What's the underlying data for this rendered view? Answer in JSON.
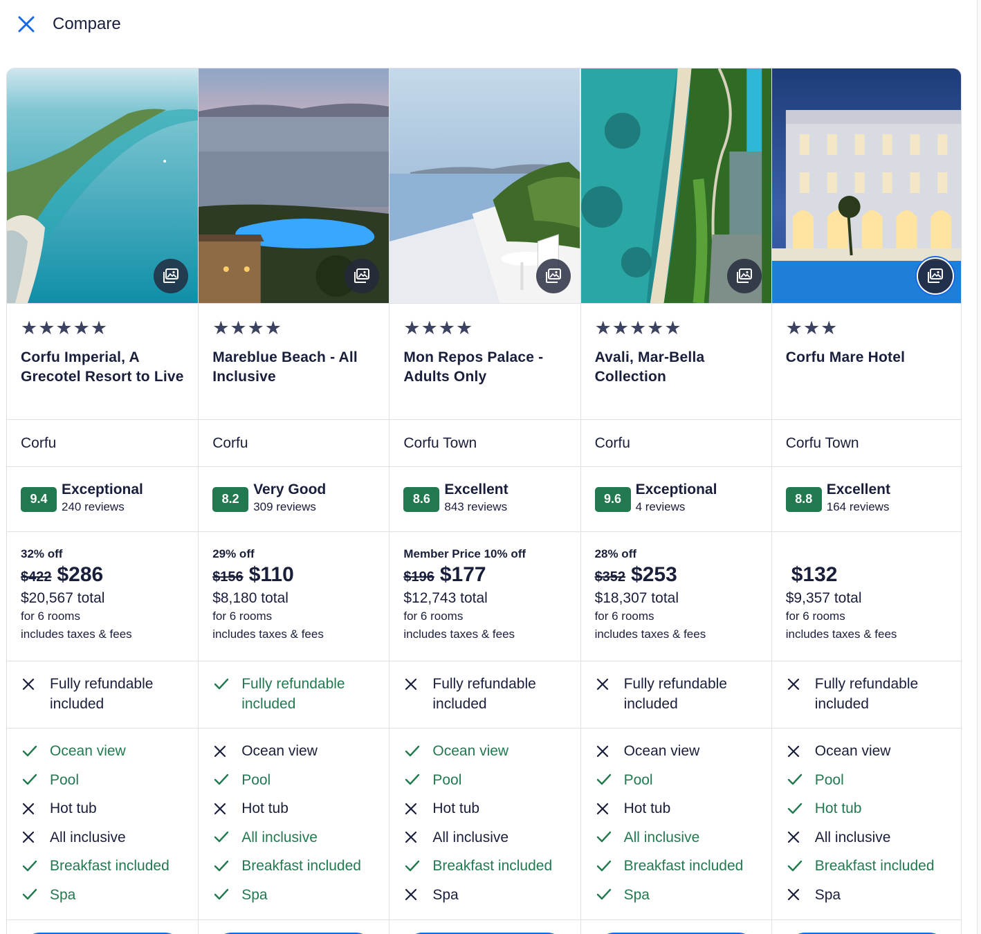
{
  "header": {
    "title": "Compare"
  },
  "colors": {
    "accent": "#1668e3",
    "positive": "#227950",
    "text": "#191e3b"
  },
  "hotels": [
    {
      "stars": "★★★★★",
      "name": "Corfu Imperial, A Grecotel Resort to Live",
      "location": "Corfu",
      "score": "9.4",
      "rating_word": "Exceptional",
      "reviews": "240 reviews",
      "discount": "32% off",
      "old_price": "$422",
      "price": "$286",
      "total": "$20,567 total",
      "rooms": "for 6 rooms",
      "taxes": "includes taxes & fees",
      "refund": {
        "label": "Fully refundable included",
        "available": false
      },
      "amenities": [
        {
          "label": "Ocean view",
          "available": true
        },
        {
          "label": "Pool",
          "available": true
        },
        {
          "label": "Hot tub",
          "available": false
        },
        {
          "label": "All inclusive",
          "available": false
        },
        {
          "label": "Breakfast included",
          "available": true
        },
        {
          "label": "Spa",
          "available": true
        }
      ]
    },
    {
      "stars": "★★★★",
      "name": "Mareblue Beach - All Inclusive",
      "location": "Corfu",
      "score": "8.2",
      "rating_word": "Very Good",
      "reviews": "309 reviews",
      "discount": "29% off",
      "old_price": "$156",
      "price": "$110",
      "total": "$8,180 total",
      "rooms": "for 6 rooms",
      "taxes": "includes taxes & fees",
      "refund": {
        "label": "Fully refundable included",
        "available": true
      },
      "amenities": [
        {
          "label": "Ocean view",
          "available": false
        },
        {
          "label": "Pool",
          "available": true
        },
        {
          "label": "Hot tub",
          "available": false
        },
        {
          "label": "All inclusive",
          "available": true
        },
        {
          "label": "Breakfast included",
          "available": true
        },
        {
          "label": "Spa",
          "available": true
        }
      ]
    },
    {
      "stars": "★★★★",
      "name": "Mon Repos Palace - Adults Only",
      "location": "Corfu Town",
      "score": "8.6",
      "rating_word": "Excellent",
      "reviews": "843 reviews",
      "discount": "Member Price 10% off",
      "old_price": "$196",
      "price": "$177",
      "total": "$12,743 total",
      "rooms": "for 6 rooms",
      "taxes": "includes taxes & fees",
      "refund": {
        "label": "Fully refundable included",
        "available": false
      },
      "amenities": [
        {
          "label": "Ocean view",
          "available": true
        },
        {
          "label": "Pool",
          "available": true
        },
        {
          "label": "Hot tub",
          "available": false
        },
        {
          "label": "All inclusive",
          "available": false
        },
        {
          "label": "Breakfast included",
          "available": true
        },
        {
          "label": "Spa",
          "available": false
        }
      ]
    },
    {
      "stars": "★★★★★",
      "name": "Avali, Mar-Bella Collection",
      "location": "Corfu",
      "score": "9.6",
      "rating_word": "Exceptional",
      "reviews": "4 reviews",
      "discount": "28% off",
      "old_price": "$352",
      "price": "$253",
      "total": "$18,307 total",
      "rooms": "for 6 rooms",
      "taxes": "includes taxes & fees",
      "refund": {
        "label": "Fully refundable included",
        "available": false
      },
      "amenities": [
        {
          "label": "Ocean view",
          "available": false
        },
        {
          "label": "Pool",
          "available": true
        },
        {
          "label": "Hot tub",
          "available": false
        },
        {
          "label": "All inclusive",
          "available": true
        },
        {
          "label": "Breakfast included",
          "available": true
        },
        {
          "label": "Spa",
          "available": true
        }
      ]
    },
    {
      "stars": "★★★",
      "name": "Corfu Mare Hotel",
      "location": "Corfu Town",
      "score": "8.8",
      "rating_word": "Excellent",
      "reviews": "164 reviews",
      "discount": "",
      "old_price": "",
      "price": "$132",
      "total": "$9,357 total",
      "rooms": "for 6 rooms",
      "taxes": "includes taxes & fees",
      "refund": {
        "label": "Fully refundable included",
        "available": false
      },
      "amenities": [
        {
          "label": "Ocean view",
          "available": false
        },
        {
          "label": "Pool",
          "available": true
        },
        {
          "label": "Hot tub",
          "available": true
        },
        {
          "label": "All inclusive",
          "available": false
        },
        {
          "label": "Breakfast included",
          "available": true
        },
        {
          "label": "Spa",
          "available": false
        }
      ]
    }
  ]
}
